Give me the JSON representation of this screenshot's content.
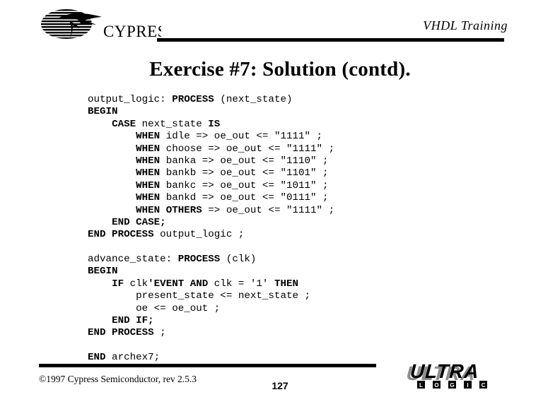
{
  "header": {
    "subtitle": "VHDL Training",
    "logo_name": "cypress-logo",
    "logo_text": "CYPRESS"
  },
  "title": "Exercise #7: Solution (contd).",
  "code": {
    "language": "VHDL",
    "lines": [
      [
        {
          "t": "output_logic: ",
          "b": false
        },
        {
          "t": "PROCESS",
          "b": true
        },
        {
          "t": " (next_state)",
          "b": false
        }
      ],
      [
        {
          "t": "BEGIN",
          "b": true
        }
      ],
      [
        {
          "t": "    ",
          "b": false
        },
        {
          "t": "CASE",
          "b": true
        },
        {
          "t": " next_state ",
          "b": false
        },
        {
          "t": "IS",
          "b": true
        }
      ],
      [
        {
          "t": "        ",
          "b": false
        },
        {
          "t": "WHEN",
          "b": true
        },
        {
          "t": " idle => oe_out <= \"1111\" ;",
          "b": false
        }
      ],
      [
        {
          "t": "        ",
          "b": false
        },
        {
          "t": "WHEN",
          "b": true
        },
        {
          "t": " choose => oe_out <= \"1111\" ;",
          "b": false
        }
      ],
      [
        {
          "t": "        ",
          "b": false
        },
        {
          "t": "WHEN",
          "b": true
        },
        {
          "t": " banka => oe_out <= \"1110\" ;",
          "b": false
        }
      ],
      [
        {
          "t": "        ",
          "b": false
        },
        {
          "t": "WHEN",
          "b": true
        },
        {
          "t": " bankb => oe_out <= \"1101\" ;",
          "b": false
        }
      ],
      [
        {
          "t": "        ",
          "b": false
        },
        {
          "t": "WHEN",
          "b": true
        },
        {
          "t": " bankc => oe_out <= \"1011\" ;",
          "b": false
        }
      ],
      [
        {
          "t": "        ",
          "b": false
        },
        {
          "t": "WHEN",
          "b": true
        },
        {
          "t": " bankd => oe_out <= \"0111\" ;",
          "b": false
        }
      ],
      [
        {
          "t": "        ",
          "b": false
        },
        {
          "t": "WHEN OTHERS",
          "b": true
        },
        {
          "t": " => oe_out <= \"1111\" ;",
          "b": false
        }
      ],
      [
        {
          "t": "    ",
          "b": false
        },
        {
          "t": "END CASE;",
          "b": true
        }
      ],
      [
        {
          "t": "END PROCESS",
          "b": true
        },
        {
          "t": " output_logic ;",
          "b": false
        }
      ],
      [
        {
          "t": "",
          "b": false
        }
      ],
      [
        {
          "t": "advance_state: ",
          "b": false
        },
        {
          "t": "PROCESS",
          "b": true
        },
        {
          "t": " (clk)",
          "b": false
        }
      ],
      [
        {
          "t": "BEGIN",
          "b": true
        }
      ],
      [
        {
          "t": "    ",
          "b": false
        },
        {
          "t": "IF",
          "b": true
        },
        {
          "t": " clk",
          "b": false
        },
        {
          "t": "'EVENT AND",
          "b": true
        },
        {
          "t": " clk = '1' ",
          "b": false
        },
        {
          "t": "THEN",
          "b": true
        }
      ],
      [
        {
          "t": "        present_state <= next_state ;",
          "b": false
        }
      ],
      [
        {
          "t": "        oe <= oe_out ;",
          "b": false
        }
      ],
      [
        {
          "t": "    ",
          "b": false
        },
        {
          "t": "END IF;",
          "b": true
        }
      ],
      [
        {
          "t": "END PROCESS",
          "b": true
        },
        {
          "t": " ;",
          "b": false
        }
      ],
      [
        {
          "t": "",
          "b": false
        }
      ],
      [
        {
          "t": "END",
          "b": true
        },
        {
          "t": " archex7;",
          "b": false
        }
      ]
    ]
  },
  "footer": {
    "copyright": "©1997 Cypress Semiconductor, rev 2.5.3",
    "page_number": "127",
    "logo_name": "ultra-logic-logo",
    "logo_word": "ULTRA",
    "logo_letters": [
      "L",
      "O",
      "G",
      "I",
      "C"
    ]
  },
  "colors": {
    "background": "#ffffff",
    "ink": "#000000",
    "logo_shadow": "#808080"
  }
}
